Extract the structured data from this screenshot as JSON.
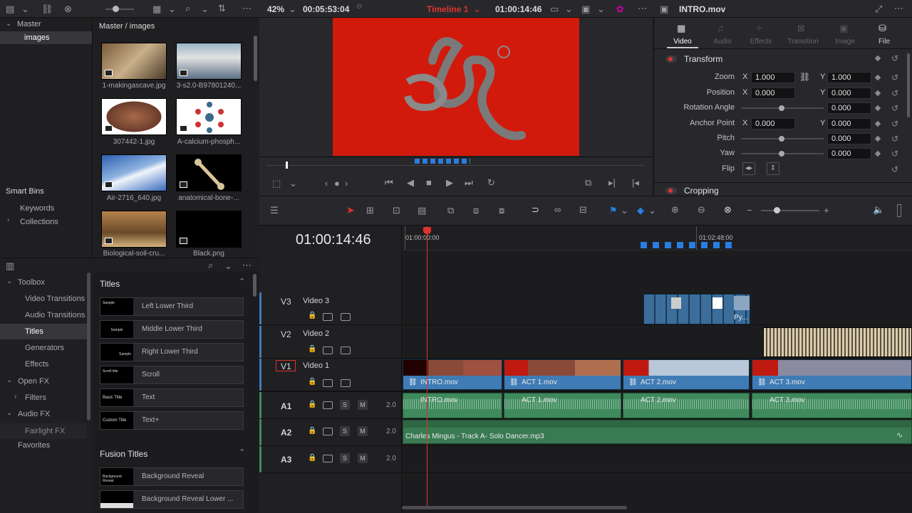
{
  "topbar": {
    "zoom": "42%",
    "timecode_duration": "00:05:53:04",
    "timeline_name": "Timeline 1",
    "timeline_timecode": "01:00:14:46",
    "clip_name": "INTRO.mov"
  },
  "bins": {
    "master": "Master",
    "images": "images",
    "smart_bins": "Smart Bins",
    "keywords": "Keywords",
    "collections": "Collections"
  },
  "mediapool": {
    "path": "Master / images",
    "items": [
      {
        "name": "1-makingascave.jpg"
      },
      {
        "name": "3-s2.0-B97801240..."
      },
      {
        "name": "307442-1.jpg"
      },
      {
        "name": "A-calcium-phosph..."
      },
      {
        "name": "Air-2716_640.jpg"
      },
      {
        "name": "anatomical-bone-..."
      },
      {
        "name": "Biological-soil-cru..."
      },
      {
        "name": "Black.png"
      }
    ]
  },
  "inspector": {
    "tabs": [
      "Video",
      "Audio",
      "Effects",
      "Transition",
      "Image",
      "File"
    ],
    "transform_label": "Transform",
    "cropping_label": "Cropping",
    "rows": {
      "zoom_label": "Zoom",
      "zoom_x": "1.000",
      "zoom_y": "1.000",
      "position_label": "Position",
      "position_x": "0.000",
      "position_y": "0.000",
      "rotation_label": "Rotation Angle",
      "rotation": "0.000",
      "anchor_label": "Anchor Point",
      "anchor_x": "0.000",
      "anchor_y": "0.000",
      "pitch_label": "Pitch",
      "pitch": "0.000",
      "yaw_label": "Yaw",
      "yaw": "0.000",
      "flip_label": "Flip"
    },
    "x": "X",
    "y": "Y"
  },
  "toolbox": {
    "items": [
      {
        "label": "Toolbox"
      },
      {
        "label": "Video Transitions"
      },
      {
        "label": "Audio Transitions"
      },
      {
        "label": "Titles"
      },
      {
        "label": "Generators"
      },
      {
        "label": "Effects"
      },
      {
        "label": "Open FX"
      },
      {
        "label": "Filters"
      },
      {
        "label": "Audio FX"
      },
      {
        "label": "Fairlight FX"
      },
      {
        "label": "Favorites"
      }
    ]
  },
  "titles": {
    "heading": "Titles",
    "fusion_heading": "Fusion Titles",
    "items": [
      {
        "label": "Left Lower Third",
        "thumb": "Sample"
      },
      {
        "label": "Middle Lower Third",
        "thumb": "Sample"
      },
      {
        "label": "Right Lower Third",
        "thumb": "Sample"
      },
      {
        "label": "Scroll",
        "thumb": "Scroll title"
      },
      {
        "label": "Text",
        "thumb": "Basic Title"
      },
      {
        "label": "Text+",
        "thumb": "Custom Title"
      }
    ],
    "fusion_items": [
      {
        "label": "Background Reveal",
        "thumb": "Background Reveal"
      },
      {
        "label": "Background Reveal Lower ..."
      }
    ]
  },
  "timeline": {
    "current_time": "01:00:14:46",
    "ruler_start": "01:00:00:00",
    "ruler_mark": "01:02:48:00",
    "tracks": {
      "v3": {
        "id": "V3",
        "name": "Video 3"
      },
      "v2": {
        "id": "V2",
        "name": "Video 2"
      },
      "v1": {
        "id": "V1",
        "name": "Video 1"
      },
      "a1": {
        "id": "A1",
        "level": "2.0"
      },
      "a2": {
        "id": "A2",
        "level": "2.0"
      },
      "a3": {
        "id": "A3",
        "level": "2.0"
      }
    },
    "video_clips": [
      "INTRO.mov",
      "ACT 1.mov",
      "ACT 2.mov",
      "ACT 3.mov"
    ],
    "audio_clips": [
      "INTRO.mov",
      "ACT 1.mov",
      "ACT 2.mov",
      "ACT 3.mov"
    ],
    "music_clip": "Charles Mingus - Track A- Solo Dancer.mp3",
    "v3_clip_label": "Py...",
    "solo": "S",
    "mute": "M"
  },
  "colors": {
    "accent_red": "#e0332c",
    "video_clip": "#3f7cb5",
    "audio_clip": "#3f8a5d",
    "marker_blue": "#2a7de1"
  }
}
